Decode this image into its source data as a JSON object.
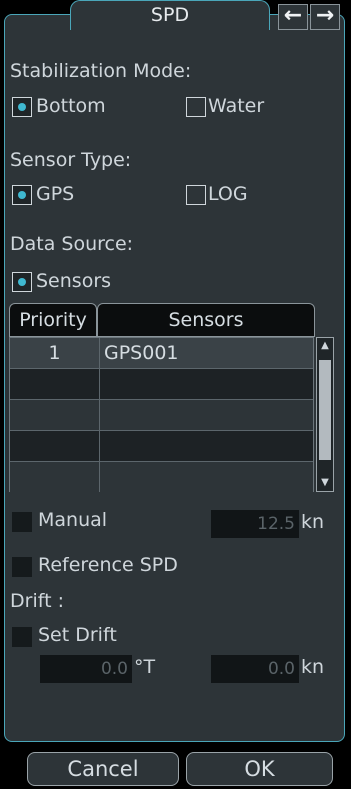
{
  "title": "SPD",
  "nav": {
    "back_icon": "left-arrow-icon",
    "forward_icon": "right-arrow-icon"
  },
  "stabilization": {
    "heading": "Stabilization Mode:",
    "options": [
      {
        "label": "Bottom",
        "selected": true
      },
      {
        "label": "Water",
        "selected": false
      }
    ]
  },
  "sensor_type": {
    "heading": "Sensor Type:",
    "options": [
      {
        "label": "GPS",
        "selected": true
      },
      {
        "label": "LOG",
        "selected": false
      }
    ]
  },
  "data_source": {
    "heading": "Data Source:",
    "options": [
      {
        "label": "Sensors",
        "selected": true
      }
    ]
  },
  "table": {
    "headers": [
      "Priority",
      "Sensors"
    ],
    "rows": [
      {
        "priority": "1",
        "sensor": "GPS001"
      },
      {
        "priority": "",
        "sensor": ""
      },
      {
        "priority": "",
        "sensor": ""
      },
      {
        "priority": "",
        "sensor": ""
      },
      {
        "priority": "",
        "sensor": ""
      }
    ]
  },
  "manual": {
    "label": "Manual",
    "value": "12.5",
    "unit": "kn",
    "checked": false
  },
  "reference_spd": {
    "label": "Reference SPD",
    "checked": false
  },
  "drift": {
    "heading": "Drift :",
    "set_label": "Set Drift",
    "checked": false,
    "direction_value": "0.0",
    "direction_unit": "°T",
    "speed_value": "0.0",
    "speed_unit": "kn"
  },
  "buttons": {
    "cancel": "Cancel",
    "ok": "OK"
  },
  "colors": {
    "accent": "#3fb8d0",
    "panel": "#2d3438",
    "border": "#4aa6b9"
  }
}
